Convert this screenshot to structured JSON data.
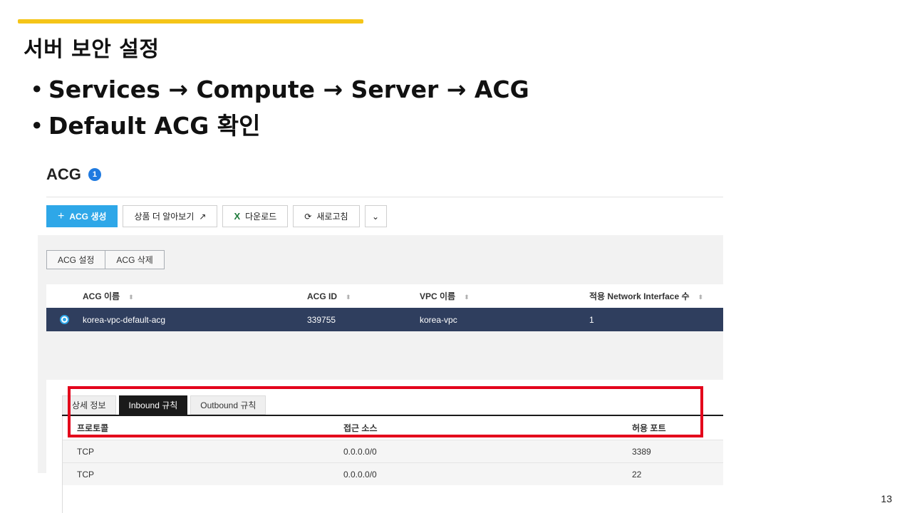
{
  "slide": {
    "title": "서버 보안 설정",
    "bullets": [
      "Services → Compute → Server → ACG",
      "Default ACG 확인"
    ],
    "bullet_glyph": "•",
    "page_number": "13",
    "accent_color": "#f5c518"
  },
  "console": {
    "title": "ACG",
    "count_badge": "1",
    "toolbar": {
      "create_label": "ACG 생성",
      "create_icon": "+",
      "learn_more_label": "상품 더 알아보기",
      "learn_more_icon": "↗",
      "download_label": "다운로드",
      "download_icon": "X",
      "refresh_label": "새로고침",
      "refresh_icon": "⟳",
      "more_icon": "⌄"
    },
    "actions": [
      "ACG 설정",
      "ACG 삭제"
    ],
    "table": {
      "columns": [
        "ACG 이름",
        "ACG ID",
        "VPC 이름",
        "적용 Network Interface 수"
      ],
      "sort_icon": "⬍",
      "rows": [
        {
          "name": "korea-vpc-default-acg",
          "id": "339755",
          "vpc": "korea-vpc",
          "nic_count": "1",
          "selected": true
        }
      ]
    },
    "detail_tabs": [
      "상세 정보",
      "Inbound 규칙",
      "Outbound 규칙"
    ],
    "active_detail_tab": "Inbound 규칙",
    "rules": {
      "columns": [
        "프로토콜",
        "접근 소스",
        "허용 포트"
      ],
      "rows": [
        {
          "protocol": "TCP",
          "source": "0.0.0.0/0",
          "port": "3389"
        },
        {
          "protocol": "TCP",
          "source": "0.0.0.0/0",
          "port": "22"
        }
      ]
    },
    "highlight_color": "#e3001b",
    "primary_color": "#2ea7e8",
    "selected_row_color": "#2f3e5e"
  }
}
